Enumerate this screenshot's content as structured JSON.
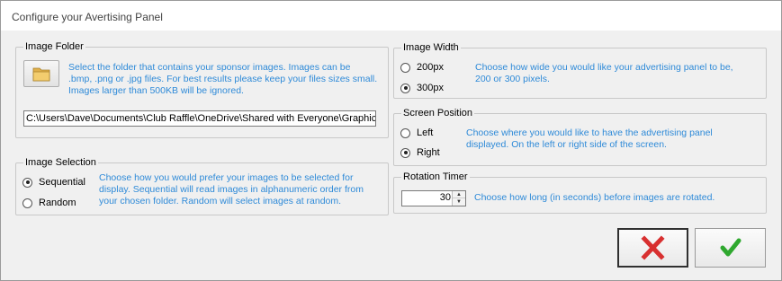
{
  "window": {
    "title": "Configure your Avertising Panel"
  },
  "image_folder": {
    "legend": "Image Folder",
    "description": "Select the folder that contains your sponsor images. Images can be .bmp, .png or .jpg files. For best results please keep your files sizes small. Images larger than 500KB will be ignored.",
    "desc_lines": [
      "Select the folder that contains your sponsor images. Images can be",
      ".bmp, .png or .jpg files. For best results please keep your files sizes small.",
      "Images larger than 500KB will be ignored."
    ],
    "path_value": "C:\\Users\\Dave\\Documents\\Club Raffle\\OneDrive\\Shared with Everyone\\Graphics\\",
    "browse_icon": "folder-icon"
  },
  "image_selection": {
    "legend": "Image Selection",
    "options": [
      {
        "label": "Sequential",
        "selected": true
      },
      {
        "label": "Random",
        "selected": false
      }
    ],
    "desc_lines": [
      "Choose how you would prefer your images to be selected for",
      "display. Sequential will read images in alphanumeric order from",
      "your chosen folder. Random will select images at random."
    ]
  },
  "image_width": {
    "legend": "Image Width",
    "options": [
      {
        "label": "200px",
        "selected": false
      },
      {
        "label": "300px",
        "selected": true
      }
    ],
    "desc_lines": [
      "Choose how wide you would like your advertising panel to be,",
      "200 or 300 pixels."
    ]
  },
  "screen_position": {
    "legend": "Screen Position",
    "options": [
      {
        "label": "Left",
        "selected": false
      },
      {
        "label": "Right",
        "selected": true
      }
    ],
    "desc_lines": [
      "Choose where you would like to have the advertising panel",
      "displayed. On the left or right side of the screen."
    ]
  },
  "rotation_timer": {
    "legend": "Rotation Timer",
    "value": "30",
    "description": "Choose how long (in seconds) before images are rotated."
  },
  "buttons": {
    "cancel_icon": "red-x-icon",
    "confirm_icon": "green-checkmark-icon"
  },
  "colors": {
    "description_text": "#2e8ad8",
    "cancel_red": "#d83030",
    "confirm_green": "#2fa82f"
  }
}
